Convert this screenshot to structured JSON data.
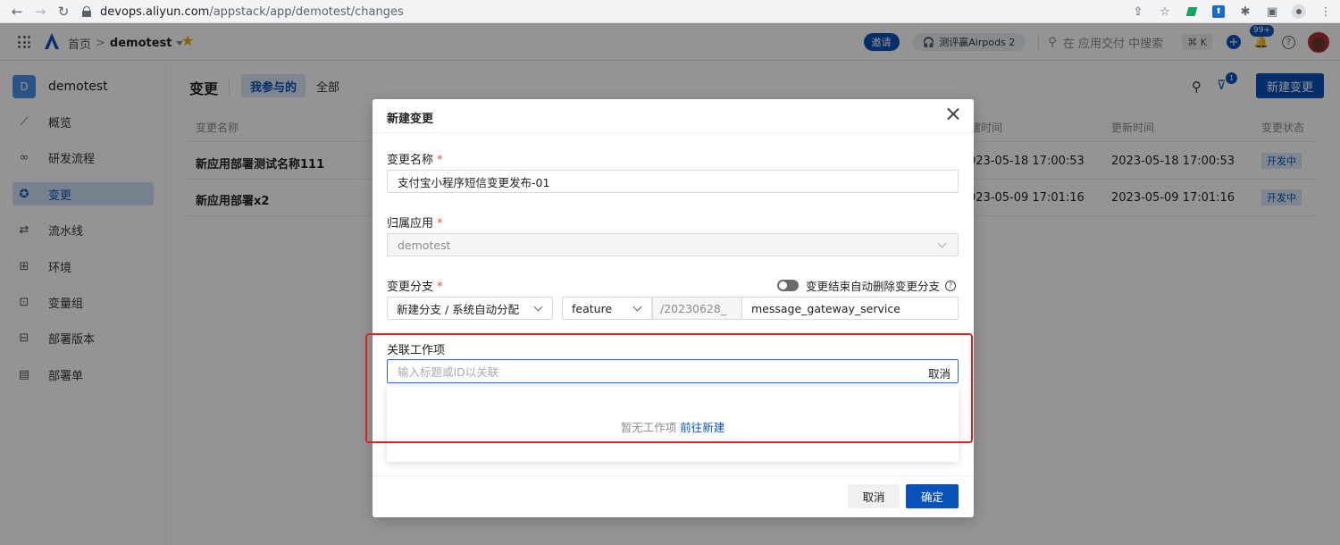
{
  "browser": {
    "url_host": "devops.aliyun.com",
    "url_path": "/appstack/app/demotest/changes"
  },
  "header": {
    "home": "首页",
    "separator": ">",
    "project": "demotest",
    "invite": "邀请",
    "promo": "测评赢Airpods 2",
    "search_placeholder": "在 应用交付 中搜索",
    "shortcut": "⌘ K",
    "notification_count": "99+"
  },
  "sidebar": {
    "project_initial": "D",
    "project_name": "demotest",
    "items": [
      {
        "label": "概览",
        "icon": "chart-icon"
      },
      {
        "label": "研发流程",
        "icon": "infinity-icon"
      },
      {
        "label": "变更",
        "icon": "change-icon"
      },
      {
        "label": "流水线",
        "icon": "pipeline-icon"
      },
      {
        "label": "环境",
        "icon": "grid-icon"
      },
      {
        "label": "变量组",
        "icon": "variable-icon"
      },
      {
        "label": "部署版本",
        "icon": "version-icon"
      },
      {
        "label": "部署单",
        "icon": "deploy-icon"
      }
    ],
    "active_index": 2
  },
  "main": {
    "title": "变更",
    "tabs": [
      "我参与的",
      "全部"
    ],
    "filter_count": "1",
    "new_button": "新建变更",
    "columns": [
      "变更名称",
      "建时间",
      "更新时间",
      "变更状态"
    ],
    "rows": [
      {
        "name": "新应用部署测试名称111",
        "created": "023-05-18 17:00:53",
        "updated": "2023-05-18 17:00:53",
        "status": "开发中"
      },
      {
        "name": "新应用部署x2",
        "created": "023-05-09 17:01:16",
        "updated": "2023-05-09 17:01:16",
        "status": "开发中"
      }
    ]
  },
  "modal": {
    "title": "新建变更",
    "name_label": "变更名称",
    "required_mark": "*",
    "name_value": "支付宝小程序短信变更发布-01",
    "app_label": "归属应用",
    "app_value": "demotest",
    "branch_label": "变更分支",
    "toggle_label": "变更结束自动删除变更分支",
    "branch_mode": "新建分支 / 系统自动分配",
    "branch_type": "feature",
    "branch_prefix": "/20230628_",
    "branch_suffix": "message_gateway_service",
    "work_label": "关联工作项",
    "work_placeholder": "输入标题或ID以关联",
    "work_cancel": "取消",
    "empty_text": "暂无工作项",
    "empty_link": "前往新建",
    "cancel_button": "取消",
    "ok_button": "确定"
  },
  "colors": {
    "brand": "#0a52b9",
    "highlight": "#e02020",
    "required": "#e34d4d"
  }
}
